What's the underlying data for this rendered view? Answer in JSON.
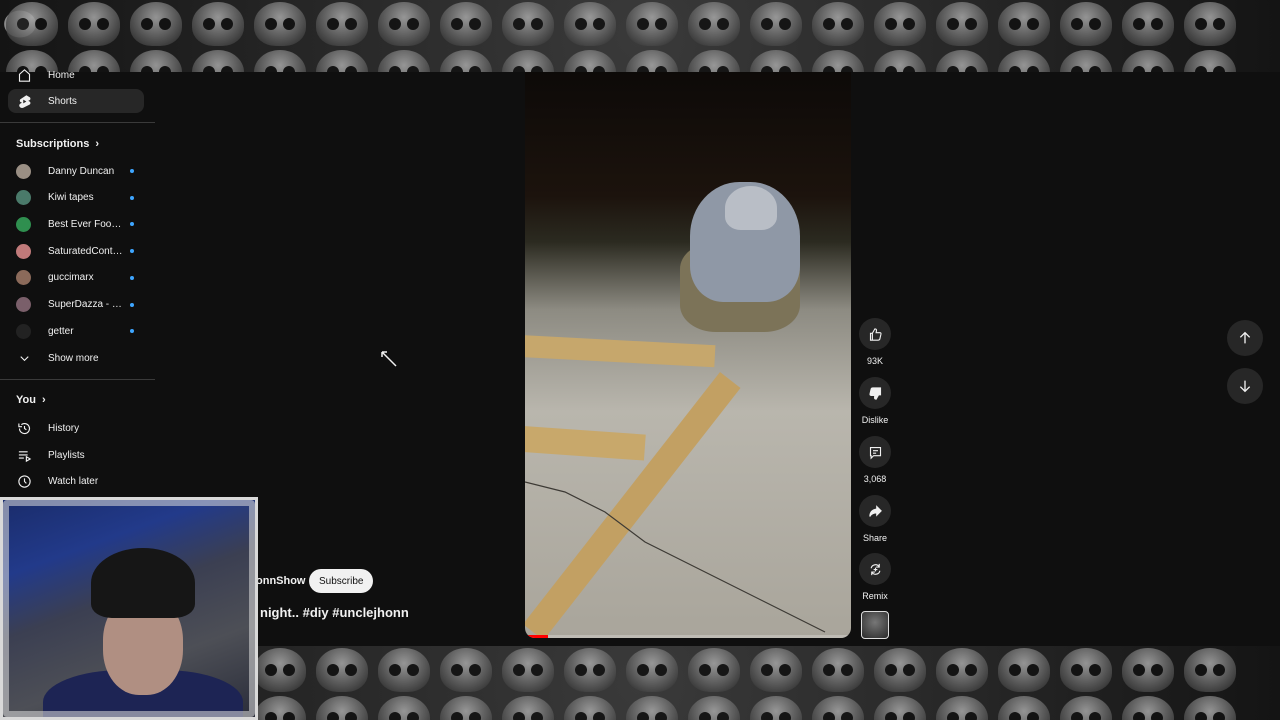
{
  "sidebar": {
    "home_label": "Home",
    "shorts_label": "Shorts",
    "subscriptions_title": "Subscriptions",
    "subscriptions": [
      {
        "name": "Danny Duncan",
        "color": "#9a8f84"
      },
      {
        "name": "Kiwi tapes",
        "color": "#4a7a6a"
      },
      {
        "name": "Best Ever Food R...",
        "color": "#2f8f4f"
      },
      {
        "name": "SaturatedContent",
        "color": "#c07a7a"
      },
      {
        "name": "guccimarx",
        "color": "#8b6a5a"
      },
      {
        "name": "SuperDazza - Be...",
        "color": "#7a5f6a"
      },
      {
        "name": "getter",
        "color": "#222222"
      }
    ],
    "show_more_label": "Show more",
    "you_title": "You",
    "history_label": "History",
    "playlists_label": "Playlists",
    "watch_later_label": "Watch later"
  },
  "short": {
    "channel_name": "onnShow",
    "subscribe_label": "Subscribe",
    "title": "night.. #diy #unclejhonn",
    "progress": 0.07,
    "accent_color": "#ff0000"
  },
  "actions": {
    "like_count": "93K",
    "dislike_label": "Dislike",
    "comments_count": "3,068",
    "share_label": "Share",
    "remix_label": "Remix"
  }
}
